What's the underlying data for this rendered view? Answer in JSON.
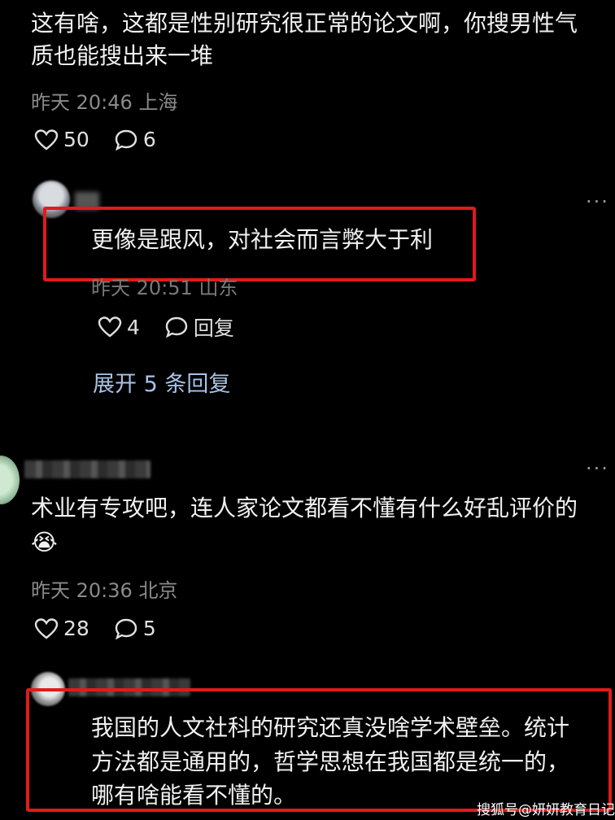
{
  "comments": [
    {
      "text_lines": [
        "这有啥，这都是性别研究很正常的论文啊，你搜男性气",
        "质也能搜出来一堆"
      ],
      "time": "昨天 20:46",
      "location": "上海",
      "likes": "50",
      "replies": "6"
    },
    {
      "text": "更像是跟风，对社会而言弊大于利",
      "time": "昨天 20:51",
      "location": "山东",
      "likes": "4",
      "reply_label": "回复",
      "expand_label": "展开 5 条回复"
    },
    {
      "text_line1": "术业有专攻吧，连人家论文都看不懂有什么好乱评价的",
      "emoji": "😭",
      "time": "昨天 20:36",
      "location": "北京",
      "likes": "28",
      "replies": "5"
    },
    {
      "text_lines": [
        "我国的人文社科的研究还真没啥学术壁垒。统计",
        "方法都是通用的，哲学思想在我国都是统一的，",
        "哪有啥能看不懂的。"
      ]
    }
  ],
  "more_label": "···",
  "watermark": "搜狐号@妍妍教育日记",
  "colors": {
    "background": "#000000",
    "text": "#f1f1f1",
    "meta": "#8a8a8a",
    "highlight_box": "#e01b1b",
    "expand_link": "#a9c2e4"
  },
  "icons": [
    "heart-icon",
    "comment-bubble-icon",
    "more-dots-icon"
  ]
}
